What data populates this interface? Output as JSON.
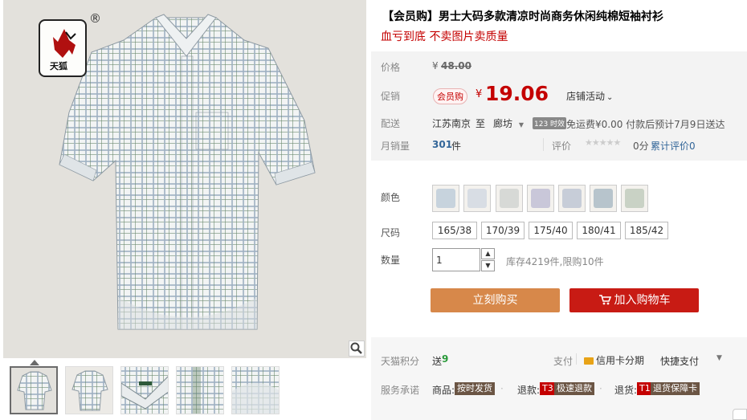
{
  "product": {
    "title": "【会员购】男士大码多款清凉时尚商务休闲纯棉短袖衬衫",
    "subtitle": "血亏到底 不卖图片卖质量",
    "brand_logo_text": "天狐",
    "brand_reg_mark": "®"
  },
  "price": {
    "label": "价格",
    "currency": "¥",
    "original": "48.00",
    "promo_label": "促销",
    "member_badge": "会员购",
    "promo_price": "19.06",
    "store_event": "店铺活动",
    "chevron": "⌄"
  },
  "delivery": {
    "label": "配送",
    "from": "江苏南京",
    "to_word": "至",
    "destination": "廊坊",
    "time_badge": "123 时效",
    "shipping_text": "免运费¥0.00 付款后预计7月9日送达"
  },
  "sales": {
    "label": "月销量",
    "count": "301",
    "unit": "件",
    "rating_label": "评价",
    "stars": "★★★★★",
    "rating_score": "0分",
    "review_count": "累计评价0"
  },
  "colors": {
    "label": "颜色",
    "swatch_tints": [
      "#c7d3dd",
      "#d8dde4",
      "#d7d9d6",
      "#c9c7d9",
      "#c7cdd8",
      "#b7c4cc",
      "#c9d2c5"
    ]
  },
  "sizes": {
    "label": "尺码",
    "options": [
      "165/38",
      "170/39",
      "175/40",
      "180/41",
      "185/42"
    ]
  },
  "quantity": {
    "label": "数量",
    "value": "1",
    "up": "▲",
    "down": "▼",
    "stock_text": "库存4219件,限购10件"
  },
  "actions": {
    "buy_now": "立刻购买",
    "add_to_cart": "加入购物车"
  },
  "footer": {
    "points_label": "天猫积分",
    "points_text": "送",
    "points_value": "9",
    "payment_label": "支付",
    "credit_installment": "信用卡分期",
    "quick_pay": "快捷支付",
    "service_label": "服务承诺",
    "goods_prefix": "商品:",
    "goods_tag": "按时发货",
    "refund_prefix": "退款:",
    "refund_code": "T3",
    "refund_tag": "极速退款",
    "return_prefix": "退货:",
    "return_code": "T1",
    "return_tag": "退货保障卡"
  },
  "colors_theme": {
    "accent_red": "#c40000",
    "buy_orange": "#d7884a",
    "cart_red": "#c81b14"
  }
}
